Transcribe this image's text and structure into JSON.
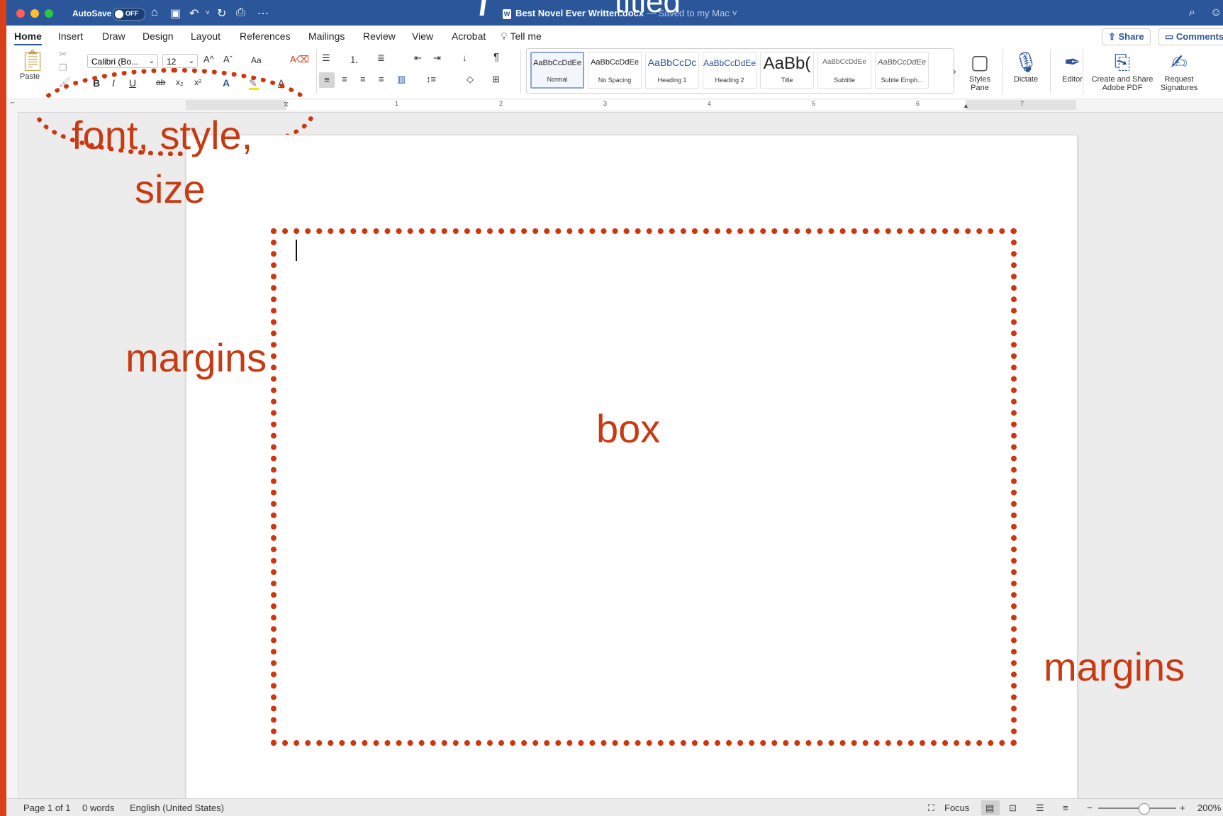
{
  "titlebar": {
    "autosave_label": "AutoSave",
    "autosave_state": "OFF",
    "doc_title": "Best Novel Ever Written.docx",
    "saved_status": " — Saved to my Mac ˅",
    "overlay_text": "titled"
  },
  "tabs": [
    "Home",
    "Insert",
    "Draw",
    "Design",
    "Layout",
    "References",
    "Mailings",
    "Review",
    "View",
    "Acrobat"
  ],
  "tell_me": "Tell me",
  "share_label": "Share",
  "comments_label": "Comments",
  "clipboard": {
    "paste_label": "Paste"
  },
  "font": {
    "name": "Calibri (Bo...",
    "size": "12",
    "grow": "A^",
    "shrink": "Aˇ",
    "change_case": "Aa",
    "bold": "B",
    "italic": "I",
    "underline": "U",
    "strike": "ab",
    "subscript": "x₂",
    "superscript": "x²"
  },
  "styles": [
    {
      "sample": "AaBbCcDdEe",
      "name": "Normal"
    },
    {
      "sample": "AaBbCcDdEe",
      "name": "No Spacing"
    },
    {
      "sample": "AaBbCcDc",
      "name": "Heading 1"
    },
    {
      "sample": "AaBbCcDdEe",
      "name": "Heading 2"
    },
    {
      "sample": "AaBb(",
      "name": "Title"
    },
    {
      "sample": "AaBbCcDdEe",
      "name": "Subtitle"
    },
    {
      "sample": "AaBbCcDdEe",
      "name": "Subtle Emph..."
    }
  ],
  "buttons": {
    "styles_pane": "Styles Pane",
    "dictate": "Dictate",
    "editor": "Editor",
    "create_share_pdf": "Create and Share Adobe PDF",
    "request_signatures": "Request Signatures"
  },
  "ruler_numbers": [
    "1",
    "2",
    "3",
    "4",
    "5",
    "6",
    "7"
  ],
  "annotations": {
    "font_style_size_line1": "font, style,",
    "font_style_size_line2": "size",
    "margins_left": "margins",
    "box": "box",
    "margins_right": "margins"
  },
  "status": {
    "page": "Page 1 of 1",
    "words": "0 words",
    "language": "English (United States)",
    "focus": "Focus",
    "zoom": "200%"
  },
  "colors": {
    "ribbon_blue": "#2b579a",
    "annotation_red": "#c83a12",
    "background_orange": "#d8401a"
  }
}
